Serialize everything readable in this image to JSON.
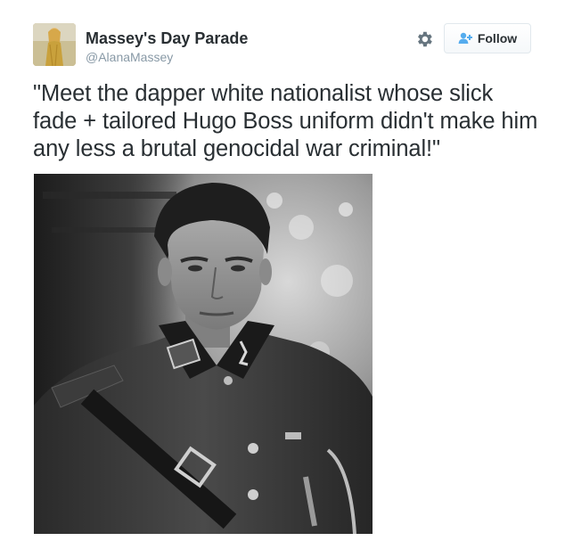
{
  "tweet": {
    "author": {
      "display_name": "Massey's Day Parade",
      "handle": "@AlanaMassey",
      "avatar_icon": "avatar-photo"
    },
    "actions": {
      "settings_icon": "gear-icon",
      "follow_icon": "add-user-icon",
      "follow_label": "Follow"
    },
    "text": "\"Meet the dapper white nationalist whose slick fade + tailored Hugo Boss uniform didn't make him any less a brutal genocidal war criminal!\"",
    "media": {
      "type": "photo"
    }
  },
  "colors": {
    "text_primary": "#292f33",
    "text_secondary": "#8899a6",
    "button_border": "#e1e8ed",
    "follow_icon": "#55acee"
  }
}
